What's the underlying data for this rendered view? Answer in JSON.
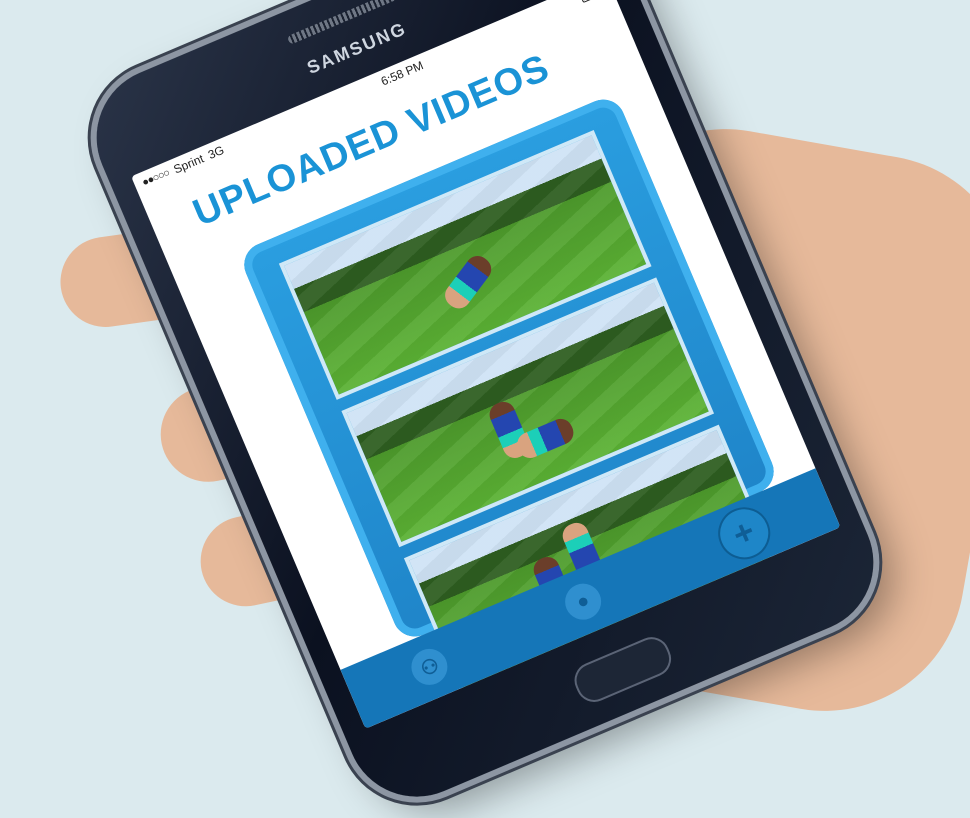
{
  "device": {
    "brand": "SAMSUNG"
  },
  "statusbar": {
    "carrier": "Sprint",
    "network": "3G",
    "time": "6:58 PM"
  },
  "app": {
    "title": "UPLOADED VIDEOS",
    "videos": [
      {
        "label": "video-1"
      },
      {
        "label": "video-2"
      },
      {
        "label": "video-3"
      }
    ]
  },
  "tabbar": {
    "icons": [
      "group-icon",
      "profile-icon",
      "add-icon"
    ],
    "add_symbol": "+"
  },
  "colors": {
    "accent": "#1a93d6",
    "panel": "#2a9ee0",
    "tabbar": "#1576b8",
    "background": "#dbeaee"
  }
}
